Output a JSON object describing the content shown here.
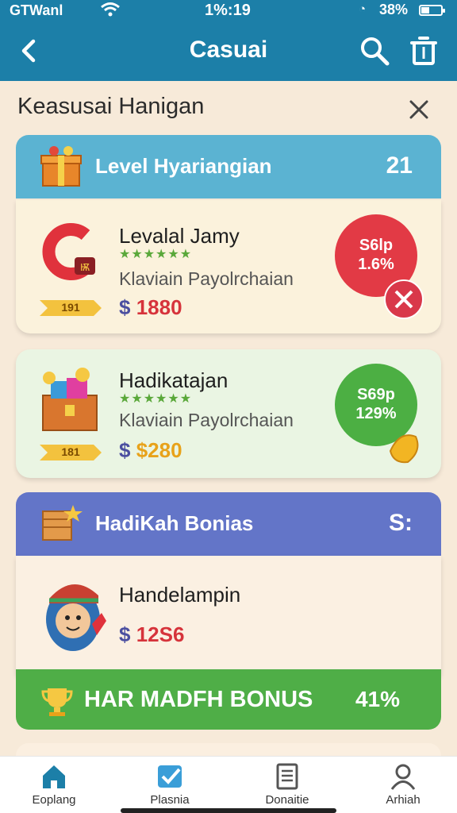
{
  "status": {
    "carrier": "GTWanl",
    "time": "1%:19",
    "battery_pct": "38%",
    "battery_level": 0.38
  },
  "header": {
    "title": "Casuai",
    "back_icon": "chevron-left-icon",
    "search_icon": "search-icon",
    "trash_icon": "trash-icon"
  },
  "panel": {
    "title": "Keasusai Hanigan",
    "close_icon": "close-icon"
  },
  "section1": {
    "title": "Level Hyariangian",
    "count": "21",
    "icon": "gift-box-icon",
    "color": "#5bb3d2"
  },
  "cards": [
    {
      "name": "Levalal Jamy",
      "stars": "★★★★★★",
      "subtitle": "Klaviain Payolrchaian",
      "price": "$ 1880",
      "price_color": "#d6333b",
      "ribbon": "191",
      "badge_line1": "S6lp",
      "badge_line2": "1.6%",
      "badge_color": "#e23a45",
      "art_icon": "magnet-icon"
    },
    {
      "name": "Hadikatajan",
      "stars": "★★★★★★",
      "subtitle": "Klaviain Payolrchaian",
      "price": "$ $280",
      "price_color": "#e8a21a",
      "ribbon": "181",
      "badge_line1": "S69p",
      "badge_line2": "129%",
      "badge_color": "#4caf43",
      "art_icon": "treasure-chest-icon"
    }
  ],
  "section2": {
    "title": "HadiKah Bonias",
    "count": "S:",
    "icon": "star-crate-icon",
    "color": "#6375c8"
  },
  "bonus_card": {
    "name": "Handelampin",
    "price": "$ 12S6",
    "price_color": "#d6333b",
    "art_icon": "avatar-icon"
  },
  "cta": {
    "label": "HAR MADFH BONUS",
    "percent": "41%",
    "icon": "trophy-icon",
    "color": "#4fae47"
  },
  "nav": [
    {
      "label": "Eoplang",
      "icon": "home-icon"
    },
    {
      "label": "Plasnia",
      "icon": "check-icon"
    },
    {
      "label": "Donaitie",
      "icon": "document-icon"
    },
    {
      "label": "Arhiah",
      "icon": "profile-icon"
    }
  ]
}
